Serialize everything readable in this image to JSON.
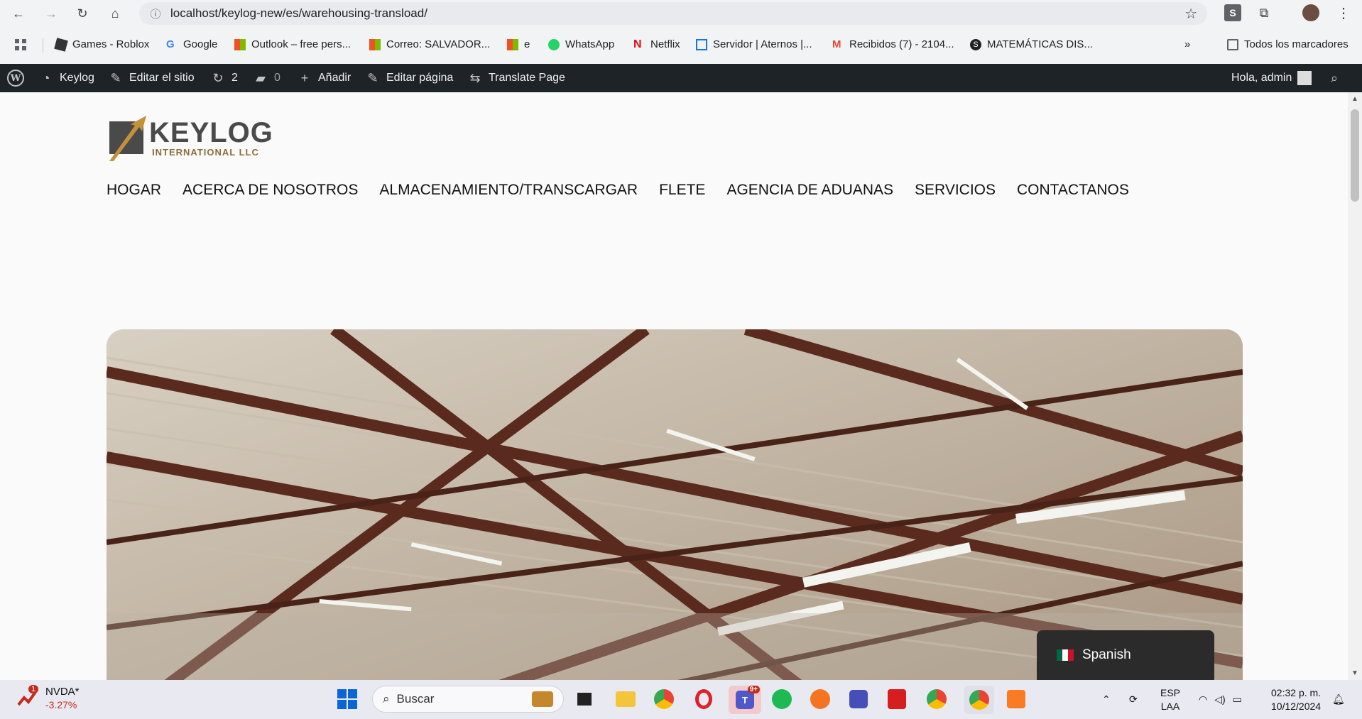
{
  "browser": {
    "url": "localhost/keylog-new/es/warehousing-transload/",
    "bookmarks": [
      {
        "label": "Games - Roblox",
        "icon": "roblox-icon",
        "color": "#333333"
      },
      {
        "label": "Google",
        "icon": "google-icon",
        "color": "#4285f4"
      },
      {
        "label": "Outlook – free pers...",
        "icon": "microsoft-icon",
        "color": "#f25022"
      },
      {
        "label": "Correo: SALVADOR...",
        "icon": "microsoft-icon",
        "color": "#f25022"
      },
      {
        "label": "e",
        "icon": "microsoft-icon",
        "color": "#f25022"
      },
      {
        "label": "WhatsApp",
        "icon": "whatsapp-icon",
        "color": "#25d366"
      },
      {
        "label": "Netflix",
        "icon": "netflix-icon",
        "color": "#e50914"
      },
      {
        "label": "Servidor | Aternos |...",
        "icon": "aternos-icon",
        "color": "#1a73e8"
      },
      {
        "label": "Recibidos (7) - 2104...",
        "icon": "gmail-icon",
        "color": "#ea4335"
      },
      {
        "label": "MATEMÁTICAS DIS...",
        "icon": "s-icon",
        "color": "#202124"
      }
    ],
    "all_bookmarks": "Todos los marcadores"
  },
  "wpbar": {
    "site": "Keylog",
    "edit_site": "Editar el sitio",
    "updates": "2",
    "comments": "0",
    "add": "Añadir",
    "edit_page": "Editar página",
    "translate": "Translate Page",
    "greeting": "Hola, admin"
  },
  "logo": {
    "word": "KEYLOG",
    "sub": "INTERNATIONAL LLC"
  },
  "nav": [
    "HOGAR",
    "ACERCA DE NOSOTROS",
    "ALMACENAMIENTO/TRANSCARGAR",
    "FLETE",
    "AGENCIA DE ADUANAS",
    "SERVICIOS",
    "CONTACTANOS"
  ],
  "language_switcher": {
    "label": "Spanish"
  },
  "taskbar": {
    "stock": {
      "name": "NVDA*",
      "change": "-3.27%",
      "badge": "1"
    },
    "search_placeholder": "Buscar",
    "teams_badge": "9+",
    "lang": [
      "ESP",
      "LAA"
    ],
    "time": "02:32 p. m.",
    "date": "10/12/2024"
  }
}
